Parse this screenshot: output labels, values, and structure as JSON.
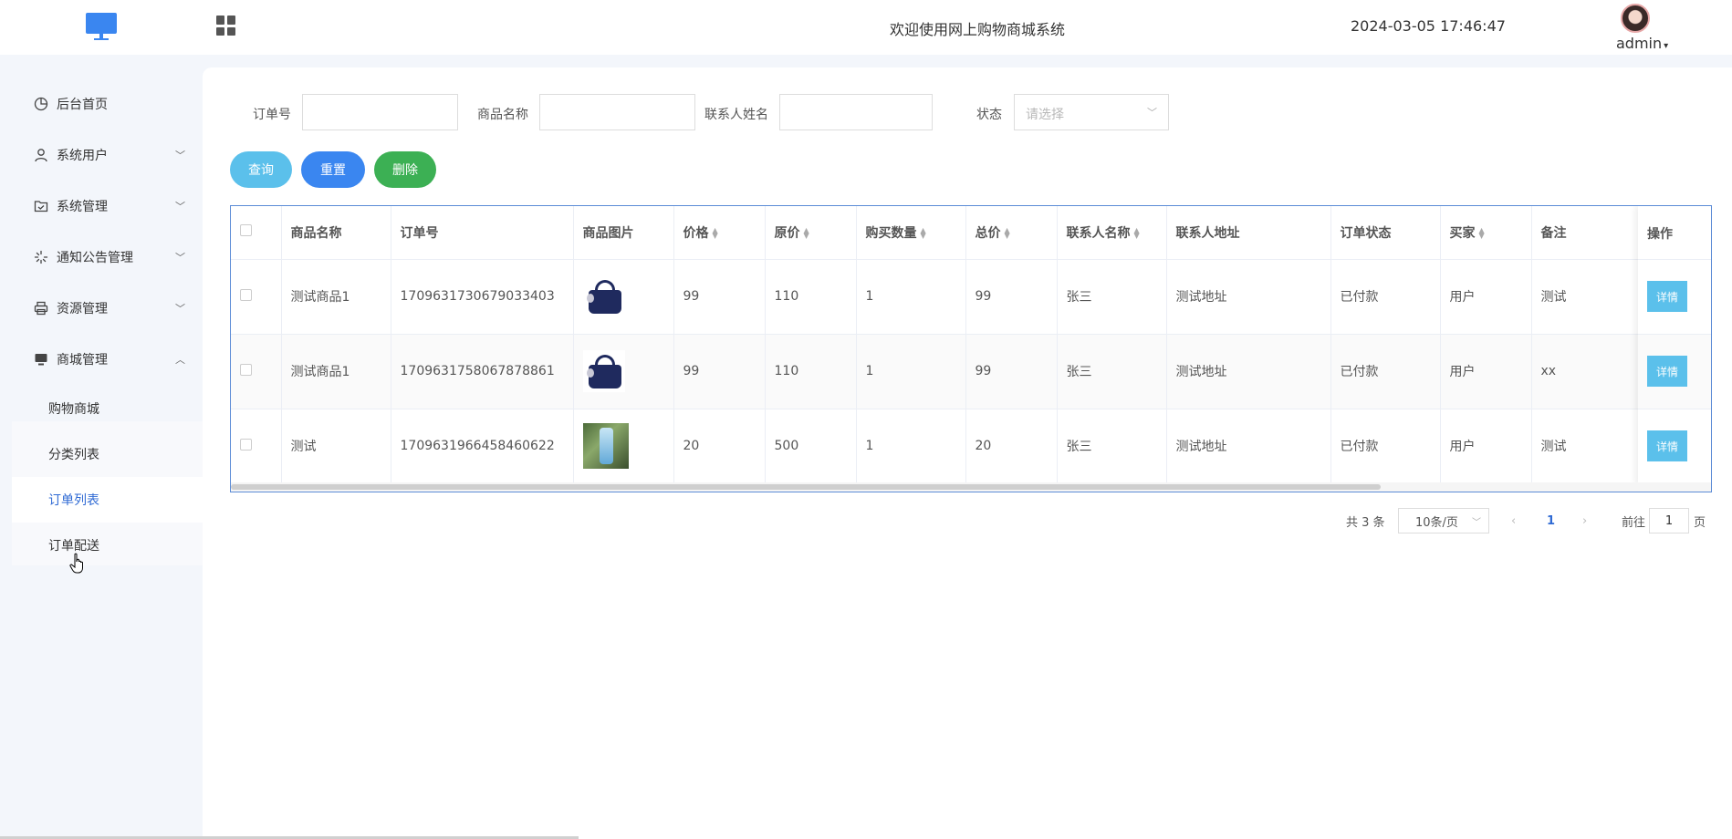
{
  "header": {
    "title": "欢迎使用网上购物商城系统",
    "datetime": "2024-03-05 17:46:47",
    "user": "admin"
  },
  "sidebar": {
    "items": [
      {
        "label": "后台首页",
        "icon": "pie-chart-icon"
      },
      {
        "label": "系统用户",
        "icon": "user-icon"
      },
      {
        "label": "系统管理",
        "icon": "folder-check-icon"
      },
      {
        "label": "通知公告管理",
        "icon": "loading-spinner-icon"
      },
      {
        "label": "资源管理",
        "icon": "printer-icon"
      },
      {
        "label": "商城管理",
        "icon": "monitor-icon"
      }
    ],
    "sub_items": [
      {
        "label": "购物商城"
      },
      {
        "label": "分类列表"
      },
      {
        "label": "订单列表"
      },
      {
        "label": "订单配送"
      }
    ]
  },
  "search": {
    "order_no_label": "订单号",
    "order_no_value": "",
    "product_name_label": "商品名称",
    "product_name_value": "",
    "contact_name_label": "联系人姓名",
    "contact_name_value": "",
    "status_label": "状态",
    "status_placeholder": "请选择"
  },
  "buttons": {
    "query": "查询",
    "reset": "重置",
    "delete": "删除"
  },
  "colors": {
    "query": "#5bc0eb",
    "reset": "#3a86f0",
    "delete": "#3cb054",
    "accent": "#2f6ad4"
  },
  "table": {
    "headers": [
      "商品名称",
      "订单号",
      "商品图片",
      "价格",
      "原价",
      "购买数量",
      "总价",
      "联系人名称",
      "联系人地址",
      "订单状态",
      "买家",
      "备注",
      "操作"
    ],
    "rows": [
      {
        "name": "测试商品1",
        "order_no": "1709631730679033403",
        "image": "handbag",
        "price": "99",
        "original_price": "110",
        "quantity": "1",
        "total": "99",
        "contact": "张三",
        "address": "测试地址",
        "status": "已付款",
        "buyer": "用户",
        "remark": "测试",
        "action": "详情"
      },
      {
        "name": "测试商品1",
        "order_no": "1709631758067878861",
        "image": "handbag",
        "price": "99",
        "original_price": "110",
        "quantity": "1",
        "total": "99",
        "contact": "张三",
        "address": "测试地址",
        "status": "已付款",
        "buyer": "用户",
        "remark": "xx",
        "action": "详情"
      },
      {
        "name": "测试",
        "order_no": "1709631966458460622",
        "image": "phone",
        "price": "20",
        "original_price": "500",
        "quantity": "1",
        "total": "20",
        "contact": "张三",
        "address": "测试地址",
        "status": "已付款",
        "buyer": "用户",
        "remark": "测试",
        "action": "详情"
      }
    ]
  },
  "pagination": {
    "total": "共 3 条",
    "page_size": "10条/页",
    "current_page": "1",
    "goto_prefix": "前往",
    "goto_value": "1",
    "goto_suffix": "页"
  }
}
